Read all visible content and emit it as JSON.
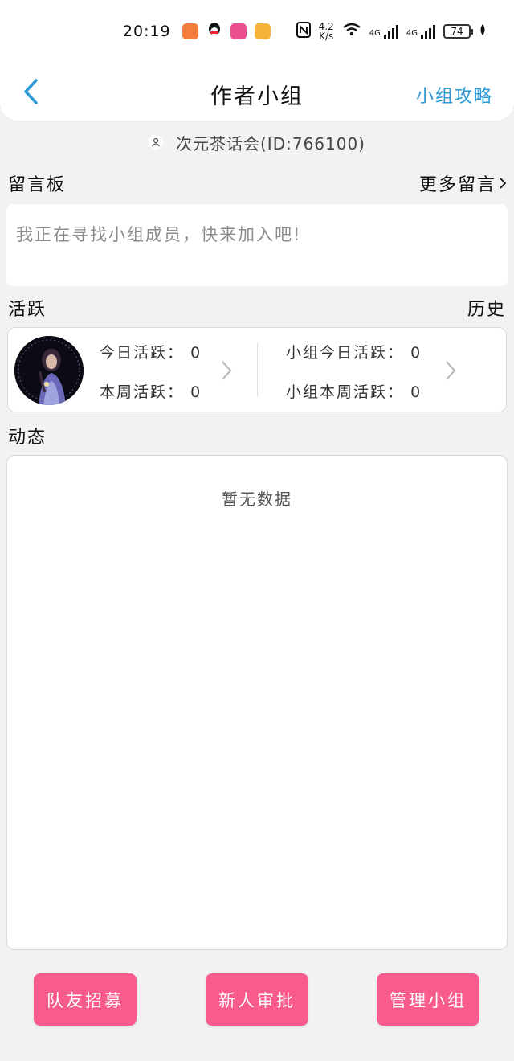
{
  "status_bar": {
    "time": "20:19",
    "net_speed_value": "4.2",
    "net_speed_unit": "K/s",
    "net_label_1": "4G",
    "net_label_2": "4G",
    "battery": "74"
  },
  "header": {
    "title": "作者小组",
    "guide_link": "小组攻略"
  },
  "group": {
    "name_id": "次元茶话会(ID:766100)"
  },
  "message_board": {
    "title": "留言板",
    "more_link": "更多留言",
    "placeholder_text": "我正在寻找小组成员，快来加入吧!"
  },
  "activity": {
    "title": "活跃",
    "history_link": "历史",
    "today_label": "今日活跃：",
    "today_value": "0",
    "week_label": "本周活跃：",
    "week_value": "0",
    "group_today_label": "小组今日活跃：",
    "group_today_value": "0",
    "group_week_label": "小组本周活跃：",
    "group_week_value": "0"
  },
  "feed": {
    "title": "动态",
    "empty_text": "暂无数据"
  },
  "actions": {
    "recruit": "队友招募",
    "approve": "新人审批",
    "manage": "管理小组"
  },
  "colors": {
    "accent_blue": "#2d9bd8",
    "button_pink": "#f85b8c",
    "background": "#f2f2f2"
  }
}
